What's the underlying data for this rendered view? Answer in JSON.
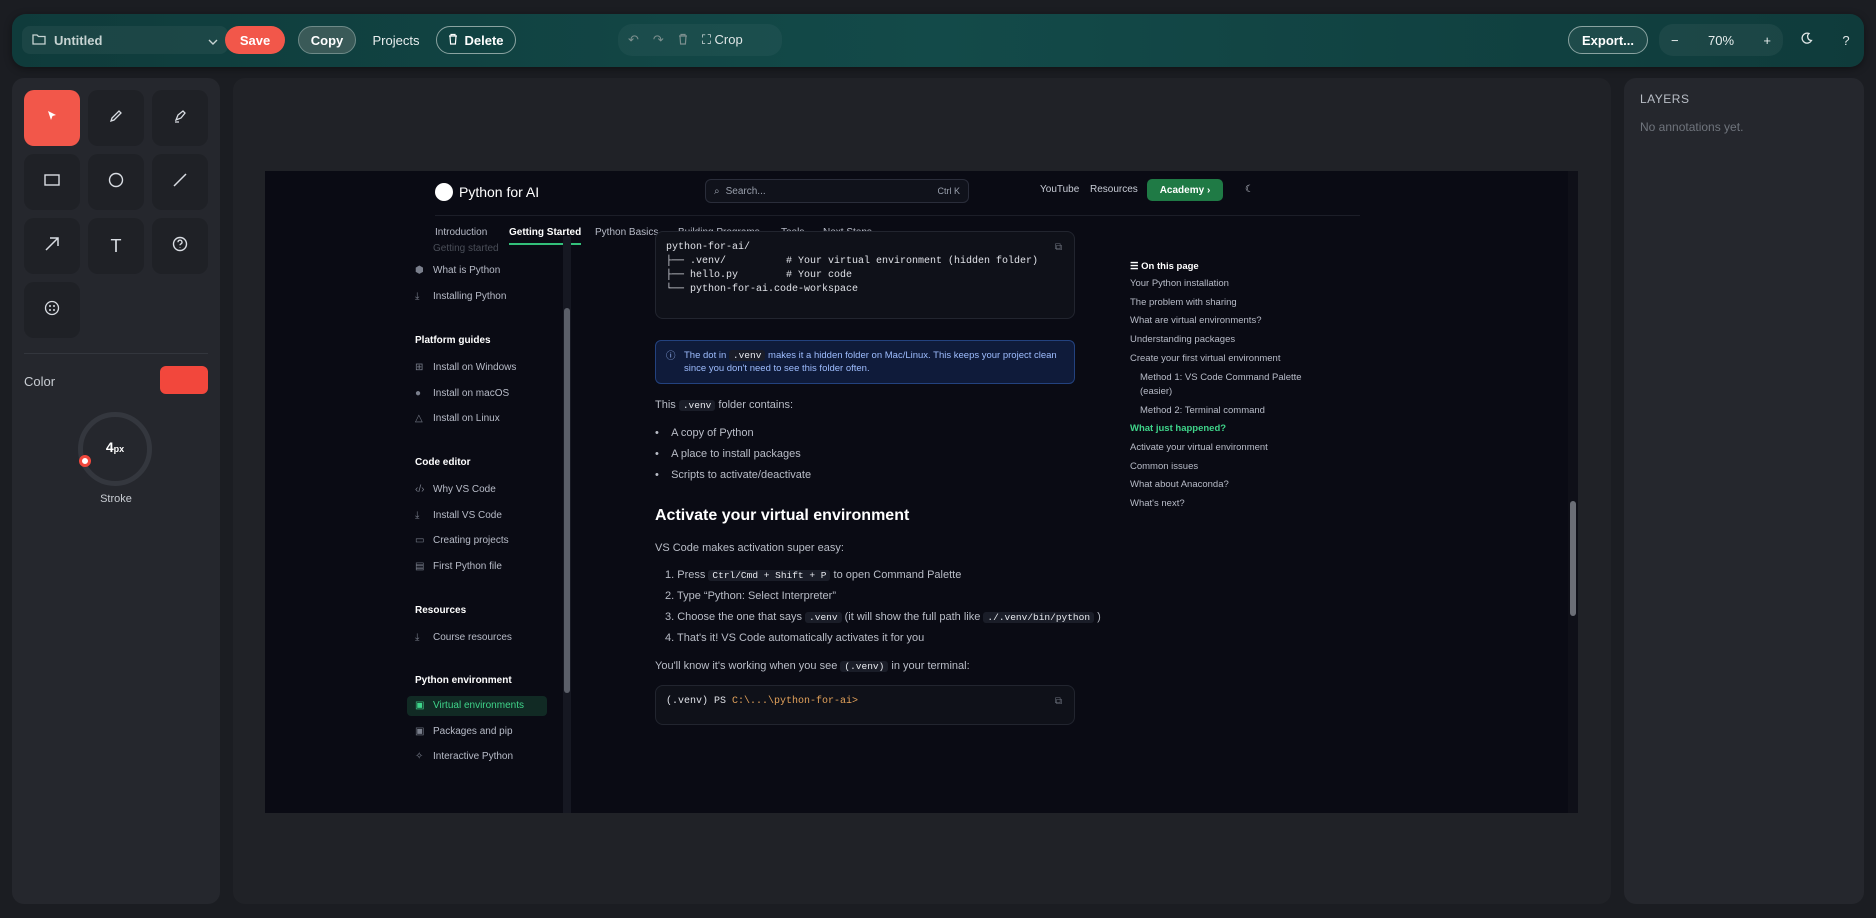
{
  "toolbar": {
    "project_name": "Untitled",
    "save": "Save",
    "copy": "Copy",
    "projects": "Projects",
    "delete": "Delete",
    "crop": "Crop",
    "export": "Export...",
    "zoom_out": "−",
    "zoom": "70%",
    "zoom_in": "+",
    "help": "?"
  },
  "tools": {
    "color_label": "Color",
    "color": "#f2473c",
    "stroke_value": "4",
    "stroke_unit": "px",
    "stroke_label": "Stroke",
    "text_tool": "T"
  },
  "layers": {
    "title": "LAYERS",
    "empty": "No annotations yet."
  },
  "site": {
    "logo": "Python for AI",
    "search_placeholder": "Search...",
    "search_kbd": "Ctrl K",
    "links": [
      "YouTube",
      "Resources"
    ],
    "academy": "Academy ›",
    "nav": [
      "Introduction",
      "Getting Started",
      "Python Basics",
      "Building Programs",
      "Tools",
      "Next Steps"
    ],
    "sidebar": {
      "faded": "Getting started",
      "setup": [
        "What is Python",
        "Installing Python"
      ],
      "platform_h": "Platform guides",
      "platform": [
        "Install on Windows",
        "Install on macOS",
        "Install on Linux"
      ],
      "editor_h": "Code editor",
      "editor": [
        "Why VS Code",
        "Install VS Code",
        "Creating projects",
        "First Python file"
      ],
      "resources_h": "Resources",
      "resources": [
        "Course resources"
      ],
      "env_h": "Python environment",
      "env": [
        "Virtual environments",
        "Packages and pip",
        "Interactive Python"
      ]
    },
    "code1": [
      "python-for-ai/",
      "├── .venv/          # Your virtual environment (hidden folder)",
      "├── hello.py        # Your code",
      "└── python-for-ai.code-workspace"
    ],
    "info_pre": "The dot in",
    "info_code": ".venv",
    "info_post": "makes it a hidden folder on Mac/Linux. This keeps your project clean since you don't need to see this folder often.",
    "this_pre": "This",
    "this_code": ".venv",
    "this_post": "folder contains:",
    "bullets": [
      "A copy of Python",
      "A place to install packages",
      "Scripts to activate/deactivate"
    ],
    "h2": "Activate your virtual environment",
    "intro": "VS Code makes activation super easy:",
    "steps": {
      "s1_pre": "1.  Press",
      "s1_code": "Ctrl/Cmd + Shift + P",
      "s1_post": "to open Command Palette",
      "s2": "2.  Type “Python: Select Interpreter”",
      "s3_pre": "3.  Choose the one that says",
      "s3_code": ".venv",
      "s3_mid": "(it will show the full path like",
      "s3_code2": "./.venv/bin/python",
      "s3_post": ")",
      "s4": "4.  That's it! VS Code automatically activates it for you"
    },
    "know_pre": "You'll know it's working when you see",
    "know_code": "(.venv)",
    "know_post": "in your terminal:",
    "code2_a": "(.venv) PS ",
    "code2_b": "C:\\...\\python-for-ai>",
    "toc_title": "On this page",
    "toc": [
      "Your Python installation",
      "The problem with sharing",
      "What are virtual environments?",
      "Understanding packages",
      "Create your first virtual environment",
      "Method 1: VS Code Command Palette",
      "(easier)",
      "Method 2: Terminal command",
      "What just happened?",
      "Activate your virtual environment",
      "Common issues",
      "What about Anaconda?",
      "What's next?"
    ]
  }
}
